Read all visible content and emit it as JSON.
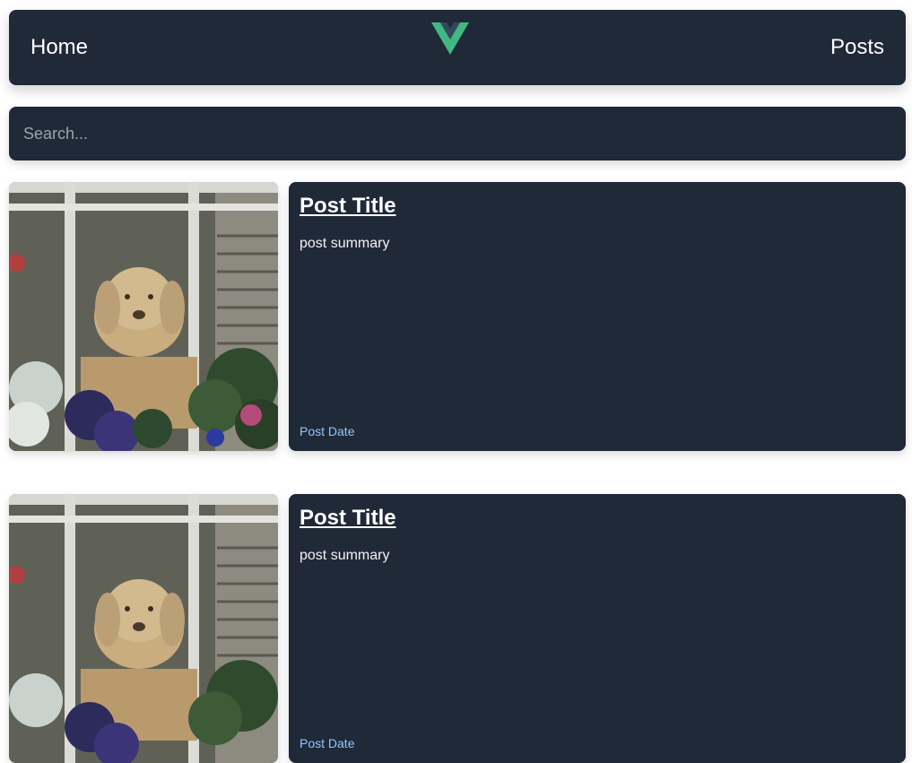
{
  "nav": {
    "home_label": "Home",
    "posts_label": "Posts",
    "logo_icon": "vue-logo-icon",
    "logo_colors": {
      "outer": "#41b883",
      "inner": "#35495e"
    }
  },
  "search": {
    "placeholder": "Search...",
    "value": ""
  },
  "posts": [
    {
      "title": "Post Title",
      "summary": "post summary",
      "date": "Post Date",
      "image": "dog-at-window-photo"
    },
    {
      "title": "Post Title",
      "summary": "post summary",
      "date": "Post Date",
      "image": "dog-at-window-photo"
    }
  ],
  "colors": {
    "card_bg": "#1f2937",
    "text": "#ffffff",
    "date": "#93c5fd",
    "placeholder": "#9ca3af"
  }
}
